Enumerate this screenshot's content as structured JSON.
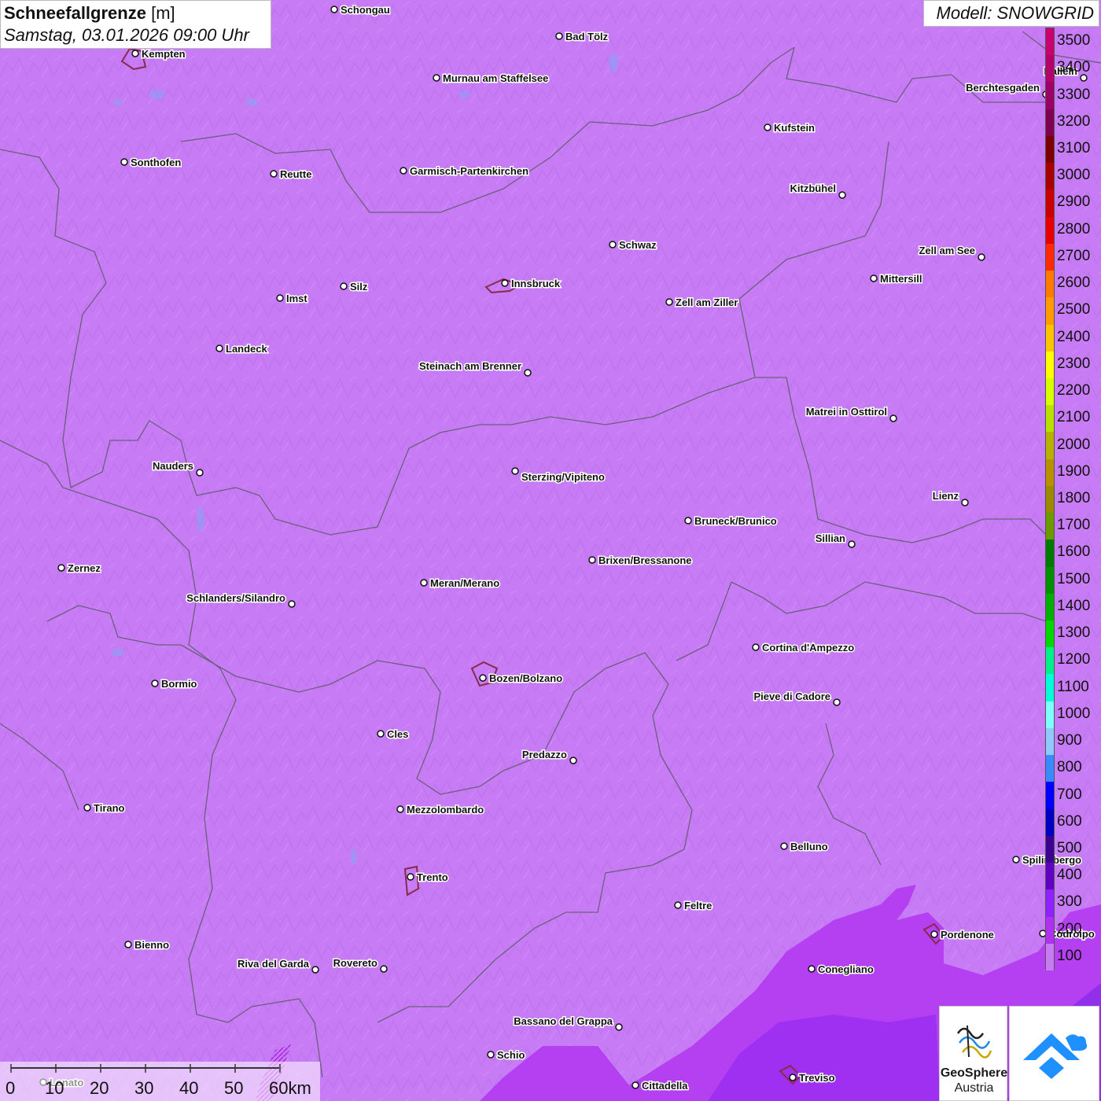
{
  "title": {
    "parameter": "Schneefallgrenze",
    "unit": "[m]",
    "datetime": "Samstag, 03.01.2026 09:00 Uhr"
  },
  "model_label": "Modell: SNOWGRID",
  "legend": {
    "labels": [
      "3500",
      "3400",
      "3300",
      "3200",
      "3100",
      "3000",
      "2900",
      "2800",
      "2700",
      "2600",
      "2500",
      "2400",
      "2300",
      "2200",
      "2100",
      "2000",
      "1900",
      "1800",
      "1700",
      "1600",
      "1500",
      "1400",
      "1300",
      "1200",
      "1100",
      "1000",
      "900",
      "800",
      "700",
      "600",
      "500",
      "400",
      "300",
      "200",
      "100"
    ],
    "colors": [
      "#c8006e",
      "#b4006a",
      "#9a0066",
      "#800050",
      "#7a0000",
      "#a80000",
      "#c80000",
      "#e60000",
      "#ff2a00",
      "#ff7a00",
      "#ff9a00",
      "#ffc400",
      "#ffff00",
      "#d8ff00",
      "#b8e000",
      "#b8b000",
      "#b89000",
      "#9a8a00",
      "#6a9a00",
      "#007a00",
      "#009000",
      "#00b000",
      "#00d800",
      "#00f08a",
      "#00ffd8",
      "#80ffff",
      "#90c8ff",
      "#3a8aff",
      "#0000ff",
      "#0000c0",
      "#3a0090",
      "#6000c0",
      "#9020ff",
      "#b030f0",
      "#c87af0"
    ]
  },
  "scale_bar": {
    "ticks": [
      "0",
      "10",
      "20",
      "30",
      "40",
      "50",
      "60km"
    ]
  },
  "logos": {
    "geosphere_line1": "GeoSphere",
    "geosphere_line2": "Austria",
    "geosphere_icon": "geosphere-logo-icon",
    "app_icon": "cloud-upload-icon"
  },
  "cities": [
    {
      "name": "Schongau"
    },
    {
      "name": "Bad Tölz"
    },
    {
      "name": "Kempten"
    },
    {
      "name": "Murnau am Staffelsee"
    },
    {
      "name": "Hallein"
    },
    {
      "name": "Berchtesgaden"
    },
    {
      "name": "Kufstein"
    },
    {
      "name": "Sonthofen"
    },
    {
      "name": "Reutte"
    },
    {
      "name": "Garmisch-Partenkirchen"
    },
    {
      "name": "Kitzbühel"
    },
    {
      "name": "Schwaz"
    },
    {
      "name": "Zell am See"
    },
    {
      "name": "Mittersill"
    },
    {
      "name": "Innsbruck"
    },
    {
      "name": "Imst"
    },
    {
      "name": "Silz"
    },
    {
      "name": "Zell am Ziller"
    },
    {
      "name": "Landeck"
    },
    {
      "name": "Steinach am Brenner"
    },
    {
      "name": "Matrei in Osttirol"
    },
    {
      "name": "Nauders"
    },
    {
      "name": "Sterzing/Vipiteno"
    },
    {
      "name": "Lienz"
    },
    {
      "name": "Bruneck/Brunico"
    },
    {
      "name": "Sillian"
    },
    {
      "name": "Brixen/Bressanone"
    },
    {
      "name": "Zernez"
    },
    {
      "name": "Meran/Merano"
    },
    {
      "name": "Schlanders/Silandro"
    },
    {
      "name": "Cortina d'Ampezzo"
    },
    {
      "name": "Bozen/Bolzano"
    },
    {
      "name": "Bormio"
    },
    {
      "name": "Pieve di Cadore"
    },
    {
      "name": "Cles"
    },
    {
      "name": "Predazzo"
    },
    {
      "name": "Tirano"
    },
    {
      "name": "Mezzolombardo"
    },
    {
      "name": "Belluno"
    },
    {
      "name": "Spilimbergo"
    },
    {
      "name": "Trento"
    },
    {
      "name": "Feltre"
    },
    {
      "name": "Pordenone"
    },
    {
      "name": "Bienno"
    },
    {
      "name": "Riva del Garda"
    },
    {
      "name": "Rovereto"
    },
    {
      "name": "Conegliano"
    },
    {
      "name": "Bassano del Grappa"
    },
    {
      "name": "Schio"
    },
    {
      "name": "Treviso"
    },
    {
      "name": "Cittadella"
    },
    {
      "name": "Lonato"
    },
    {
      "name": "Codroipo"
    }
  ]
}
